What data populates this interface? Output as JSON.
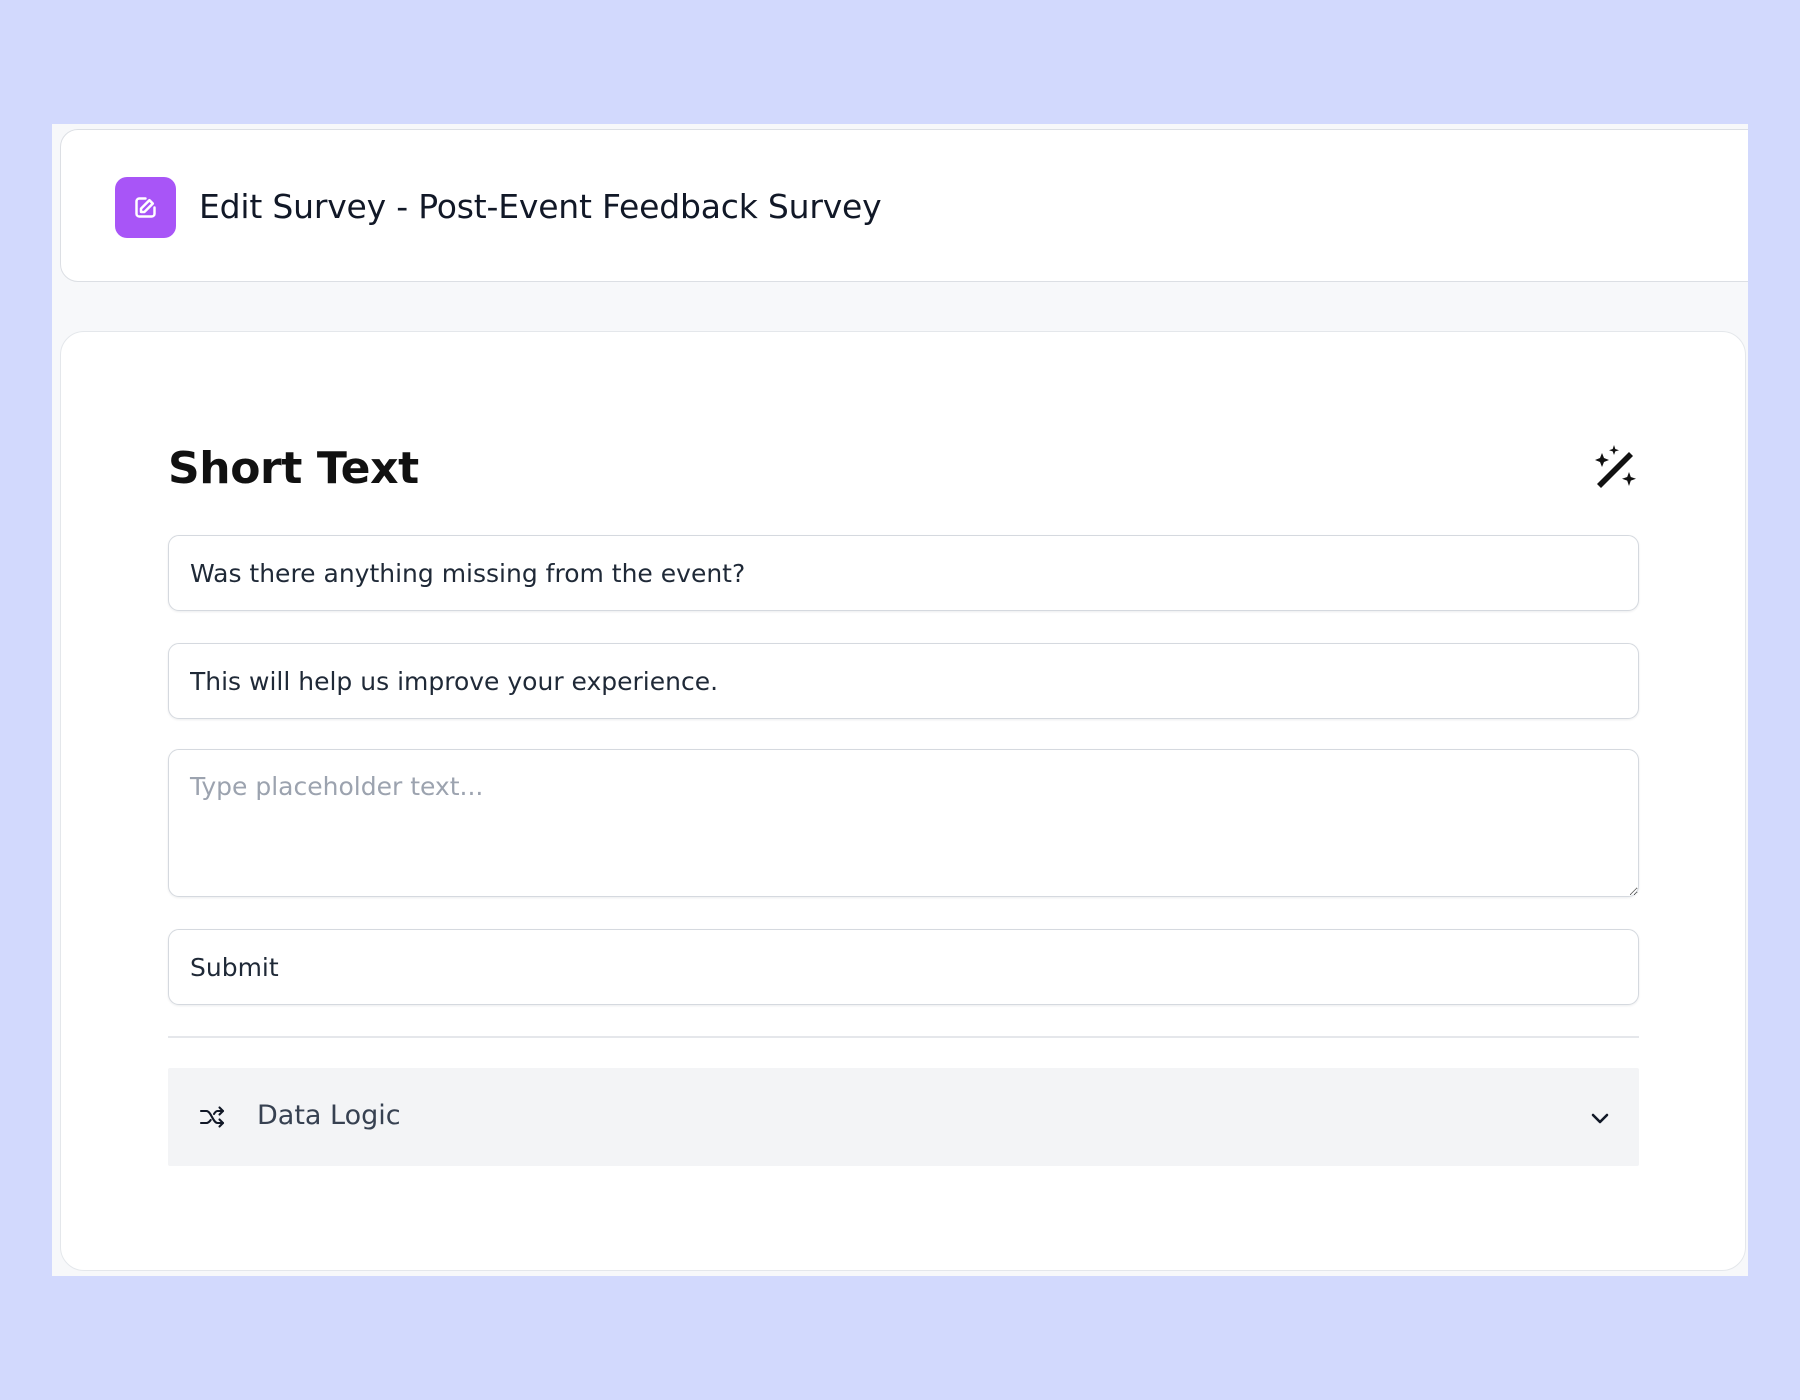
{
  "header": {
    "title": "Edit Survey - Post-Event Feedback Survey",
    "icon": "edit-icon",
    "accent_color": "#a855f7"
  },
  "editor": {
    "section_title": "Short Text",
    "action_icon": "magic-wand-icon",
    "question_text": "Was there anything missing from the event?",
    "description_text": "This will help us improve your experience.",
    "placeholder_value": "",
    "placeholder_hint": "Type placeholder text...",
    "button_label": "Submit",
    "data_logic": {
      "label": "Data Logic",
      "icon": "shuffle-icon",
      "toggle_icon": "chevron-down-icon"
    }
  },
  "colors": {
    "canvas": "#d2d9fd",
    "panel": "#f3f4f6",
    "text": "#111827",
    "muted_text": "#9ca3af"
  }
}
